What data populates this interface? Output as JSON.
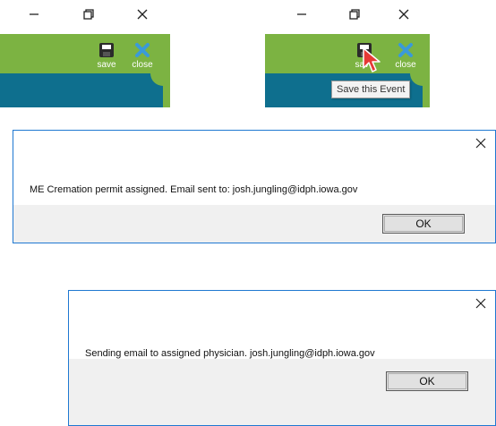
{
  "toolbar_before": {
    "save_label": "save",
    "close_label": "close"
  },
  "toolbar_after": {
    "save_label": "save",
    "close_label": "close",
    "tooltip": "Save this Event"
  },
  "dialog_permit": {
    "message": "ME Cremation permit assigned.  Email sent to: josh.jungling@idph.iowa.gov",
    "ok_label": "OK"
  },
  "dialog_email": {
    "message": "Sending email to assigned physician. josh.jungling@idph.iowa.gov",
    "ok_label": "OK"
  },
  "colors": {
    "toolbar_green": "#7cb342",
    "header_teal": "#0e6f8e",
    "close_icon_blue": "#3a9ad9",
    "dialog_border": "#1f78d1"
  },
  "icons": [
    "minimize-icon",
    "restore-icon",
    "close-window-icon",
    "save-icon",
    "close-x-icon",
    "mouse-cursor-icon",
    "dialog-close-icon"
  ]
}
